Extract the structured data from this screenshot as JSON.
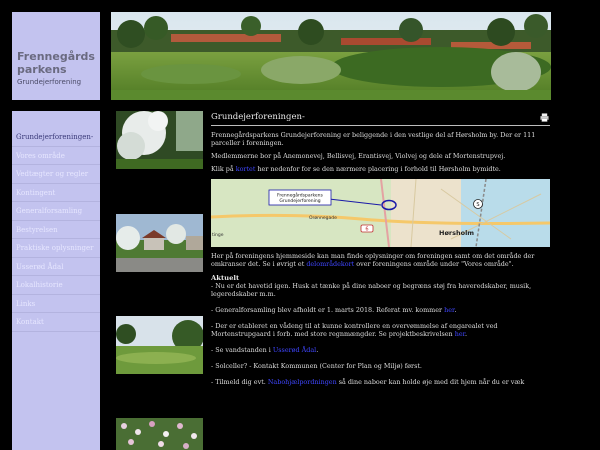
{
  "logo": {
    "title_line1": "Frennegårds",
    "title_line2": "parkens",
    "subtitle": "Grundejerforening"
  },
  "nav": {
    "items": [
      "Grundejerforeningen-",
      "Vores område",
      "Vedtægter og regler",
      "Kontingent",
      "Generalforsamling",
      "Bestyrelsen",
      "Praktiske oplysninger",
      "Usserød Ådal",
      "Lokalhistorie",
      "Links",
      "Kontakt"
    ],
    "active_index": 0
  },
  "content": {
    "title": "Grundejerforeningen-",
    "p1": "Frennegårdsparkens Grundejerforening er beliggende i den vestlige del af Hørsholm by. Der er 111 parceller i foreningen.",
    "p2": "Medlemmerne bor på Anemonevej, Bellisvej, Erantisvej, Violvej og dele af Mortenstrupvej.",
    "p3_pre": "Klik på ",
    "p3_link": "kortet",
    "p3_post": " her nedenfor for se den nærmere placering i forhold til Hørsholm bymidte.",
    "p4_pre": "Her på foreningens hjemmeside kan man finde oplysninger om foreningen samt om det område der omkranser det. Se i øvrigt et ",
    "p4_link": "delområdekort",
    "p4_post": " over foreningens område under \"Vores område\"."
  },
  "map": {
    "callout_line1": "Frennegårdsparkens",
    "callout_line2": "Grundejerforening",
    "road_label": "Orønnegade",
    "town_label": "Hørsholm",
    "left_label": "tinge",
    "route_badge": "6",
    "s_badge": "S"
  },
  "aktuelt": {
    "heading": "Aktuelt",
    "n1": "- Nu er det havetid igen. Husk at tænke på dine naboer og begræns støj fra haveredskaber, musik, legeredskaber m.m.",
    "n2_pre": "- Generalforsamling blev afholdt er 1. marts 2018. Referat mv. kommer ",
    "n2_link": "her",
    "n2_post": ".",
    "n3_pre": "- Der er etableret en vådeng til at kunne kontrollere en overvømmelse af engarealet ved Mortenstrupgaard i forb. med store regnmængder. Se projektbeskrivelsen ",
    "n3_link": "her",
    "n3_post": ".",
    "n4_pre": "- Se vandstanden i ",
    "n4_link": "Usserød Ådal",
    "n4_post": ".",
    "n5": "- Solceller? - Kontakt Kommunen (Center for Plan og Miljø) først.",
    "n6_pre": "- Tilmeld dig evt. ",
    "n6_link": "Nabohjælpordningen",
    "n6_post": " så dine naboer kan holde øje med dit hjem når du er væk"
  },
  "colors": {
    "sidebar_bg": "#c3c3ef",
    "link": "#3f46ff",
    "page_bg": "#000000"
  }
}
